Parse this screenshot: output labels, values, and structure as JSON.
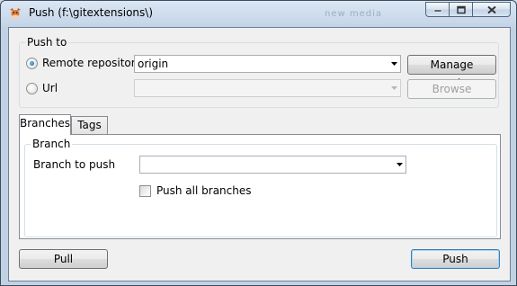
{
  "window": {
    "title": "Push (f:\\gitextensions\\)",
    "background_hint": "new media",
    "icons": {
      "app": "git-extensions-cow-icon",
      "minimize": "minimize-icon",
      "maximize": "maximize-icon",
      "close": "close-icon"
    }
  },
  "push_to": {
    "legend": "Push to",
    "remote_option": {
      "label": "Remote repository",
      "selected": true
    },
    "remote_value": "origin",
    "manage_remotes_label": "Manage remotes",
    "url_option": {
      "label": "Url",
      "selected": false
    },
    "url_value": "",
    "browse_label": "Browse"
  },
  "tabs": [
    {
      "label": "Branches",
      "active": true
    },
    {
      "label": "Tags",
      "active": false
    }
  ],
  "branch_group": {
    "legend": "Branch",
    "branch_to_push_label": "Branch to push",
    "branch_to_push_value": "",
    "push_all_label": "Push all branches",
    "push_all_checked": false
  },
  "footer": {
    "pull_label": "Pull",
    "push_label": "Push"
  }
}
